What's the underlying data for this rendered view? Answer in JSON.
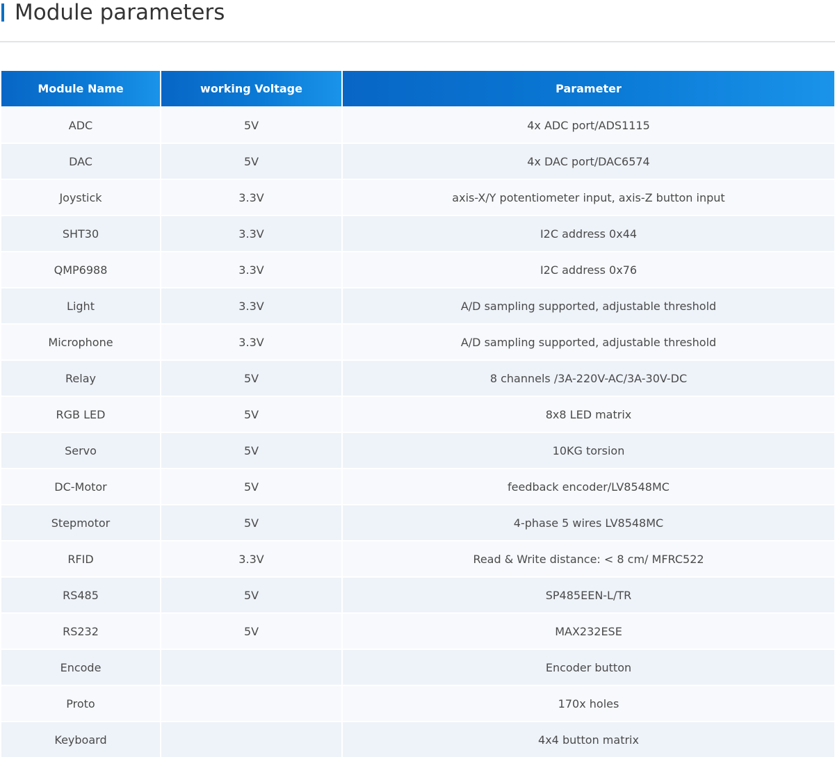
{
  "page": {
    "title": "Module parameters",
    "accent_color": "#0a6fc2",
    "header_color": "#0a72d0"
  },
  "table": {
    "headers": [
      "Module Name",
      "working Voltage",
      "Parameter"
    ],
    "rows": [
      {
        "name": "ADC",
        "voltage": "5V",
        "parameter": "4x ADC port/ADS1115"
      },
      {
        "name": "DAC",
        "voltage": "5V",
        "parameter": "4x DAC port/DAC6574"
      },
      {
        "name": "Joystick",
        "voltage": "3.3V",
        "parameter": "axis-X/Y potentiometer input, axis-Z button input"
      },
      {
        "name": "SHT30",
        "voltage": "3.3V",
        "parameter": "I2C address 0x44"
      },
      {
        "name": "QMP6988",
        "voltage": "3.3V",
        "parameter": "I2C address 0x76"
      },
      {
        "name": "Light",
        "voltage": "3.3V",
        "parameter": "A/D sampling supported, adjustable threshold"
      },
      {
        "name": "Microphone",
        "voltage": "3.3V",
        "parameter": "A/D sampling supported, adjustable threshold"
      },
      {
        "name": "Relay",
        "voltage": "5V",
        "parameter": "8 channels /3A-220V-AC/3A-30V-DC"
      },
      {
        "name": "RGB LED",
        "voltage": "5V",
        "parameter": "8x8 LED matrix"
      },
      {
        "name": "Servo",
        "voltage": "5V",
        "parameter": "10KG torsion"
      },
      {
        "name": "DC-Motor",
        "voltage": "5V",
        "parameter": "feedback encoder/LV8548MC"
      },
      {
        "name": "Stepmotor",
        "voltage": "5V",
        "parameter": "4-phase 5 wires LV8548MC"
      },
      {
        "name": "RFID",
        "voltage": "3.3V",
        "parameter": "Read & Write distance: < 8 cm/ MFRC522"
      },
      {
        "name": "RS485",
        "voltage": "5V",
        "parameter": "SP485EEN-L/TR"
      },
      {
        "name": "RS232",
        "voltage": "5V",
        "parameter": "MAX232ESE"
      },
      {
        "name": "Encode",
        "voltage": "",
        "parameter": "Encoder button"
      },
      {
        "name": "Proto",
        "voltage": "",
        "parameter": "170x holes"
      },
      {
        "name": "Keyboard",
        "voltage": "",
        "parameter": "4x4 button matrix"
      }
    ]
  }
}
